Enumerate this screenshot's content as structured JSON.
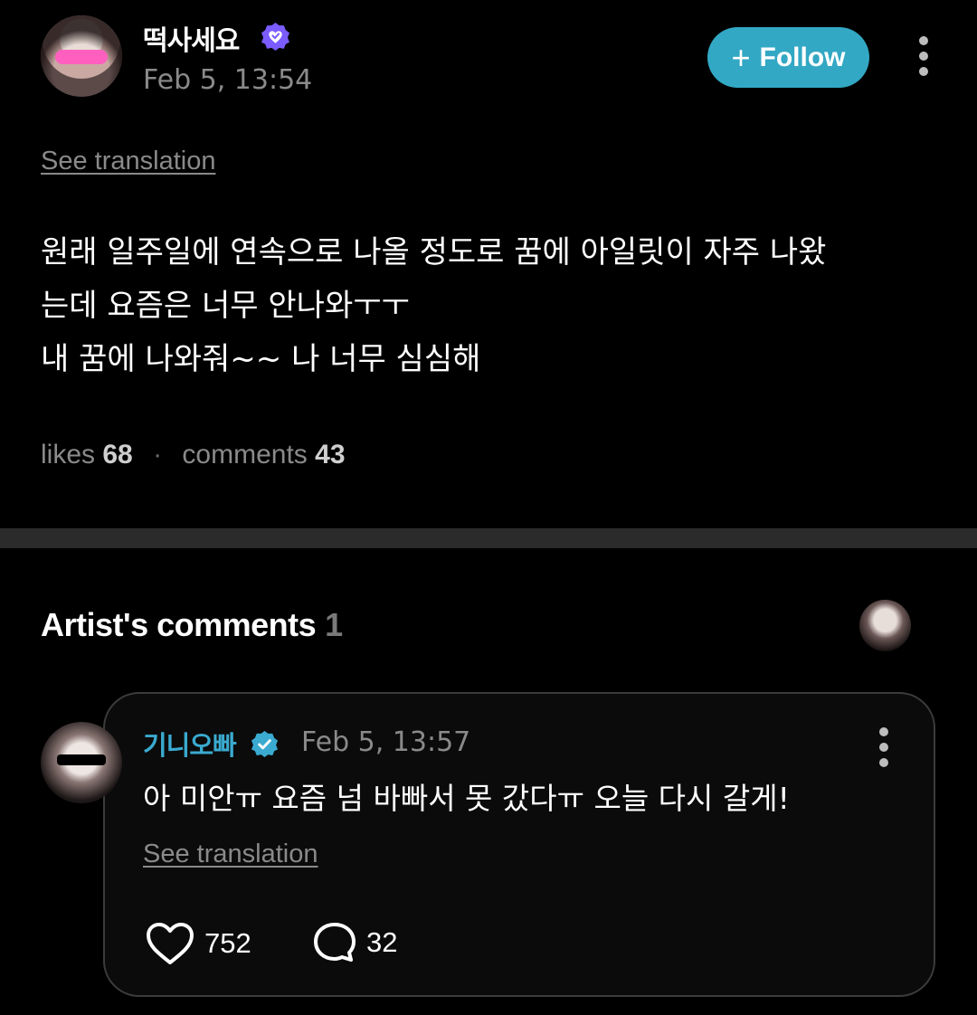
{
  "post": {
    "author": "떡사세요",
    "timestamp": "Feb 5, 13:54",
    "follow_label": "Follow",
    "see_translation": "See translation",
    "body_lines": [
      "원래 일주일에 연속으로 나올 정도로 꿈에 아일릿이 자주 나왔",
      "는데 요즘은 너무 안나와ㅜㅜ",
      "내 꿈에 나와줘~~ 나 너무 심심해"
    ],
    "likes_label": "likes",
    "likes_count": "68",
    "comments_label": "comments",
    "comments_count": "43"
  },
  "artist_comments": {
    "title": "Artist's comments",
    "count": "1"
  },
  "comment": {
    "author": "기니오빠",
    "timestamp": "Feb 5, 13:57",
    "text": "아 미안ㅠ 요즘 넘 바빠서 못 갔다ㅠ 오늘 다시 갈게!",
    "see_translation": "See translation",
    "likes": "752",
    "replies": "32"
  },
  "colors": {
    "background": "#000000",
    "follow_button": "#32a8c4",
    "artist_name": "#3aaad0",
    "fan_badge": "#7a5cff",
    "muted_text": "#8a8a8a"
  },
  "icons": [
    "fan-verified-badge-icon",
    "artist-verified-badge-icon",
    "more-vertical-icon",
    "heart-icon",
    "comment-bubble-icon",
    "plus-icon"
  ]
}
